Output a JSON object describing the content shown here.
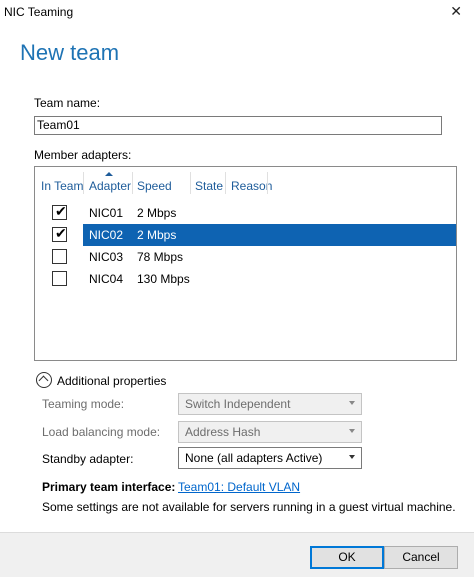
{
  "window": {
    "title": "NIC Teaming",
    "close_glyph": "✕"
  },
  "heading": "New team",
  "team_name": {
    "label": "Team name:",
    "value": "Team01"
  },
  "member_adapters": {
    "label": "Member adapters:",
    "columns": [
      "In Team",
      "Adapter",
      "Speed",
      "State",
      "Reason"
    ],
    "rows": [
      {
        "in_team": true,
        "adapter": "NIC01",
        "speed": "2 Mbps",
        "state": "",
        "reason": ""
      },
      {
        "in_team": true,
        "adapter": "NIC02",
        "speed": "2 Mbps",
        "state": "",
        "reason": "",
        "selected": true
      },
      {
        "in_team": false,
        "adapter": "NIC03",
        "speed": "78 Mbps",
        "state": "",
        "reason": ""
      },
      {
        "in_team": false,
        "adapter": "NIC04",
        "speed": "130 Mbps",
        "state": "",
        "reason": ""
      }
    ]
  },
  "additional": {
    "label": "Additional properties",
    "teaming_mode": {
      "label": "Teaming mode:",
      "value": "Switch Independent"
    },
    "load_balancing": {
      "label": "Load balancing mode:",
      "value": "Address Hash"
    },
    "standby": {
      "label": "Standby adapter:",
      "value": "None (all adapters Active)"
    },
    "primary_interface": {
      "label": "Primary team interface:",
      "value": "Team01: Default VLAN"
    },
    "note": "Some settings are not available for servers running in a guest virtual machine."
  },
  "buttons": {
    "ok": "OK",
    "cancel": "Cancel"
  },
  "colors": {
    "heading": "#1e73b4",
    "selection": "#0e63b2",
    "link": "#0066cc"
  }
}
